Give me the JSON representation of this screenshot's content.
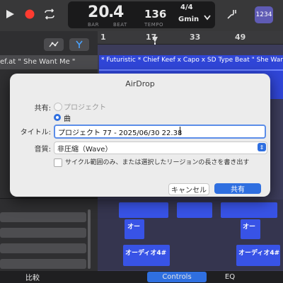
{
  "transport": {
    "bar_value": "20",
    "beat_value": "4",
    "tempo_value": "136",
    "time_signature": "4/4",
    "key": "Gmin",
    "bar_label": "BAR",
    "beat_label": "BEAT",
    "tempo_label": "TEMPO",
    "count_in_label": "1234"
  },
  "tracks": {
    "header_track_name": "ef.at \" She Want Me \"",
    "top_region_label": "* Futuristic * Chief Keef x Capo x SD Type Beat \" She Want M",
    "audio_region_label_1": "オーディオ4#",
    "audio_region_label_2": "オーディオ4#",
    "audio_region_label_3": "オー",
    "audio_region_label_4": "オー"
  },
  "ruler": {
    "marks": [
      "1",
      "17",
      "33",
      "49"
    ]
  },
  "dialog": {
    "title": "AirDrop",
    "share_label": "共有:",
    "option_project": "プロジェクト",
    "option_song": "曲",
    "selected_option": "曲",
    "title_label": "タイトル:",
    "title_value": "プロジェクト 77 - 2025/06/30 22.38",
    "quality_label": "音質:",
    "quality_value": "非圧縮（Wave）",
    "checkbox_label": "サイクル範囲のみ、または選択したリージョンの長さを書き出す",
    "checkbox_checked": false,
    "cancel_label": "キャンセル",
    "share_button_label": "共有"
  },
  "bottom_tabs": {
    "compare": "比較",
    "controls": "Controls",
    "eq": "EQ"
  },
  "colors": {
    "accent": "#2f6fe0",
    "region": "#3046d8",
    "record": "#ff3b30"
  }
}
